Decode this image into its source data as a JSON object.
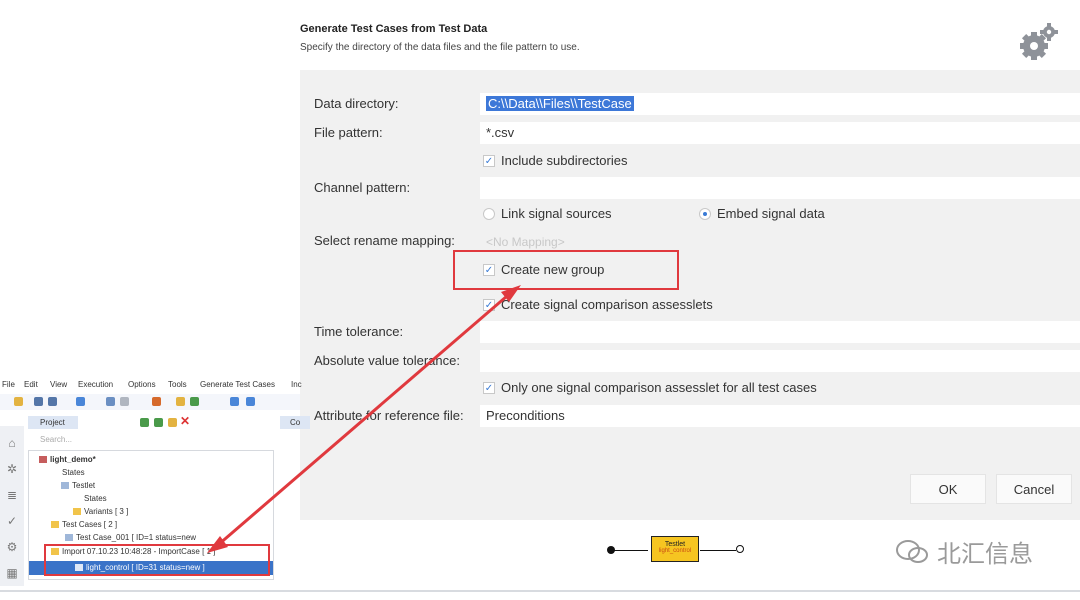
{
  "dialog": {
    "title": "Generate Test Cases from Test Data",
    "subtitle": "Specify the directory of the data files and the file pattern to use.",
    "fields": {
      "data_directory_label": "Data directory:",
      "data_directory_value": "C:\\\\Data\\\\Files\\\\TestCase",
      "file_pattern_label": "File pattern:",
      "file_pattern_value": "*.csv",
      "include_subdirs_label": "Include subdirectories",
      "channel_pattern_label": "Channel pattern:",
      "channel_pattern_value": "",
      "link_signal_label": "Link signal sources",
      "embed_signal_label": "Embed signal data",
      "rename_mapping_label": "Select rename mapping:",
      "rename_mapping_value": "<No Mapping>",
      "create_group_label": "Create new group",
      "create_assesslets_label": "Create signal comparison assesslets",
      "time_tolerance_label": "Time tolerance:",
      "time_tolerance_value": "",
      "abs_tolerance_label": "Absolute value tolerance:",
      "abs_tolerance_value": "",
      "one_assesslet_label": "Only one signal comparison assesslet for all test cases",
      "attr_reference_label": "Attribute for reference file:",
      "attr_reference_value": "Preconditions"
    },
    "buttons": {
      "ok": "OK",
      "cancel": "Cancel"
    }
  },
  "ide": {
    "menu": [
      "File",
      "Edit",
      "View",
      "Execution",
      "Options",
      "Tools",
      "Generate Test Cases",
      "Inc"
    ],
    "project_tab": "Project",
    "second_tab": "Co",
    "search_placeholder": "Search...",
    "tree": {
      "root": "light_demo*",
      "states": "States",
      "testlet": "Testlet",
      "states_child": "States",
      "variants": "Variants  [ 3 ]",
      "test_cases": "Test Cases  [ 2 ]",
      "test_case_001": "Test Case_001  [ ID=1 status=new",
      "import": "Import 07.10.23 10:48:28 - ImportCase  [ 1 ]",
      "light_control": "light_control  [ ID=31 status=new ]"
    }
  },
  "flow": {
    "box_name": "Testlet",
    "box_sub": "light_control"
  },
  "watermark": "北汇信息",
  "colors": {
    "highlight_red": "#e0393e",
    "selection_blue": "#3a73c8",
    "flow_box": "#f6c521"
  }
}
